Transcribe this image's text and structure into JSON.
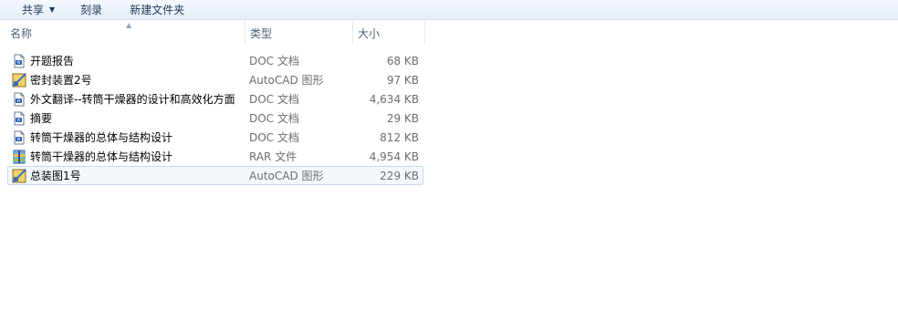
{
  "toolbar": {
    "share_label": "共享",
    "burn_label": "刻录",
    "new_folder_label": "新建文件夹"
  },
  "columns": {
    "name": "名称",
    "type": "类型",
    "size": "大小"
  },
  "files": [
    {
      "name": "开题报告",
      "type": "DOC 文档",
      "size": "68 KB",
      "icon": "doc-file-icon"
    },
    {
      "name": "密封装置2号",
      "type": "AutoCAD 图形",
      "size": "97 KB",
      "icon": "autocad-file-icon"
    },
    {
      "name": "外文翻译--转筒干燥器的设计和高效化方面",
      "type": "DOC 文档",
      "size": "4,634 KB",
      "icon": "doc-file-icon"
    },
    {
      "name": "摘要",
      "type": "DOC 文档",
      "size": "29 KB",
      "icon": "doc-file-icon"
    },
    {
      "name": "转筒干燥器的总体与结构设计",
      "type": "DOC 文档",
      "size": "812 KB",
      "icon": "doc-file-icon"
    },
    {
      "name": "转筒干燥器的总体与结构设计",
      "type": "RAR 文件",
      "size": "4,954 KB",
      "icon": "rar-file-icon"
    },
    {
      "name": "总装图1号",
      "type": "AutoCAD 图形",
      "size": "229 KB",
      "icon": "autocad-file-icon",
      "selected": true
    }
  ]
}
